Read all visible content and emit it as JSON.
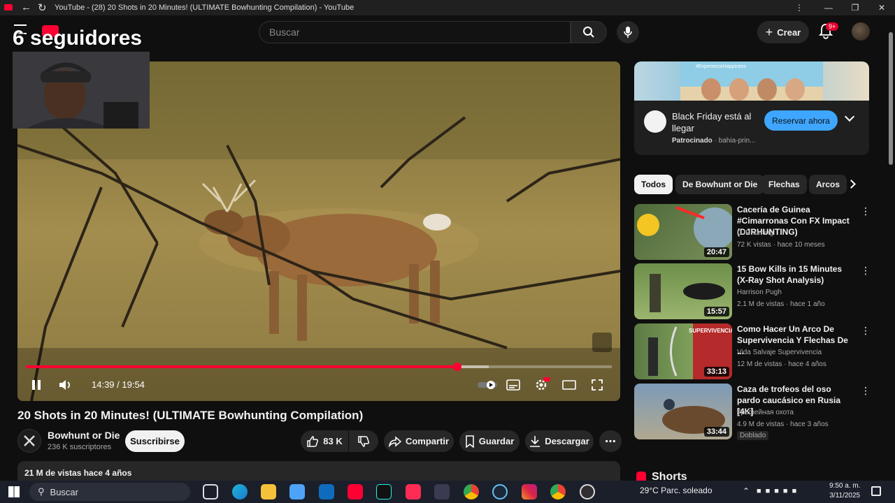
{
  "browser": {
    "tab_title": "YouTube - (28) 20 Shots in 20 Minutes! (ULTIMATE Bowhunting Compilation) - YouTube"
  },
  "overlay": {
    "followers": "6 seguidores"
  },
  "header": {
    "search_placeholder": "Buscar",
    "create_label": "Crear",
    "notifications_badge": "9+"
  },
  "player": {
    "time": "14:39 / 19:54",
    "progress": 0.736,
    "buffered": 0.79
  },
  "video": {
    "title": "20 Shots in 20 Minutes! (ULTIMATE Bowhunting Compilation)",
    "channel": "Bowhunt or Die",
    "subscribers": "236 K suscriptores",
    "subscribe_label": "Suscribirse",
    "likes": "83 K",
    "share_label": "Compartir",
    "save_label": "Guardar",
    "download_label": "Descargar",
    "description_stats": "21 M de vistas  hace 4 años"
  },
  "ad": {
    "banner_text": "#ExperienceHappiness",
    "title": "Black Friday está al llegar",
    "sponsored": "Patrocinado",
    "domain": "bahia-prin...",
    "cta": "Reservar ahora"
  },
  "chips": [
    "Todos",
    "De Bowhunt or Die",
    "Flechas",
    "Arcos"
  ],
  "recommendations": [
    {
      "title": "Cacería de Guinea #Cimarronas Con FX Impact (DJRHUNTING)",
      "channel": "DJRhunting",
      "meta": "72 K vistas · hace 10 meses",
      "duration": "20:47",
      "badge": ""
    },
    {
      "title": "15 Bow Kills in 15 Minutes (X-Ray Shot Analysis)",
      "channel": "Harrison Pugh",
      "meta": "2.1 M de vistas · hace 1 año",
      "duration": "15:57",
      "badge": ""
    },
    {
      "title": "Como Hacer Un Arco De Supervivencia Y Flechas De ...",
      "channel": "Vida Salvaje Supervivencia",
      "meta": "12 M de vistas · hace 4 años",
      "duration": "33:13",
      "badge": "",
      "thumb_label": "SUPERVIVENCIA"
    },
    {
      "title": "Caza de trofeos del oso pardo caucásico en Rusia [4K]",
      "channel": "Трофейная охота",
      "meta": "4.9 M de vistas · hace 3 años",
      "duration": "33:44",
      "badge": "Doblado"
    }
  ],
  "shorts_label": "Shorts",
  "taskbar": {
    "search_label": "Buscar",
    "weather": "29°C  Parc. soleado",
    "time": "9:50 a. m.",
    "date": "3/11/2025"
  },
  "colors": {
    "progress": "#ff0033",
    "cta": "#3ea6ff",
    "background": "#0f0f0f"
  }
}
